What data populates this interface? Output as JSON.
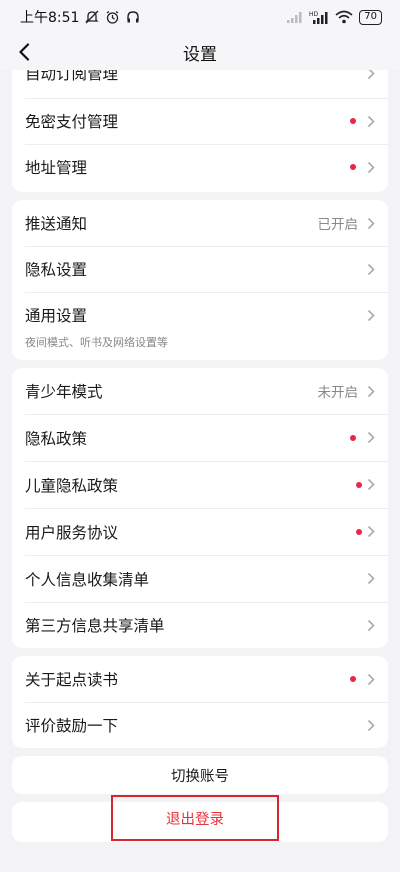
{
  "status": {
    "time": "上午8:51",
    "battery": "70",
    "network": "HD"
  },
  "header": {
    "title": "设置"
  },
  "groups": [
    {
      "items": [
        {
          "label": "自动订阅管理",
          "value": "",
          "dot": false
        },
        {
          "label": "免密支付管理",
          "value": "",
          "dot": true
        },
        {
          "label": "地址管理",
          "value": "",
          "dot": true
        }
      ]
    },
    {
      "items": [
        {
          "label": "推送通知",
          "value": "已开启",
          "dot": false
        },
        {
          "label": "隐私设置",
          "value": "",
          "dot": false
        },
        {
          "label": "通用设置",
          "value": "",
          "dot": false,
          "sub": "夜间模式、听书及网络设置等"
        }
      ]
    },
    {
      "items": [
        {
          "label": "青少年模式",
          "value": "未开启",
          "dot": false
        },
        {
          "label": "隐私政策",
          "value": "",
          "dot": true
        },
        {
          "label": "儿童隐私政策",
          "value": "",
          "dot": true
        },
        {
          "label": "用户服务协议",
          "value": "",
          "dot": true
        },
        {
          "label": "个人信息收集清单",
          "value": "",
          "dot": false
        },
        {
          "label": "第三方信息共享清单",
          "value": "",
          "dot": false
        }
      ]
    },
    {
      "items": [
        {
          "label": "关于起点读书",
          "value": "",
          "dot": true
        },
        {
          "label": "评价鼓励一下",
          "value": "",
          "dot": false
        }
      ]
    }
  ],
  "actions": {
    "switch_account": "切换账号",
    "logout": "退出登录"
  },
  "colors": {
    "accent_red": "#e8264a",
    "background": "#f3f3f5",
    "highlight_box": "#d9262e"
  }
}
